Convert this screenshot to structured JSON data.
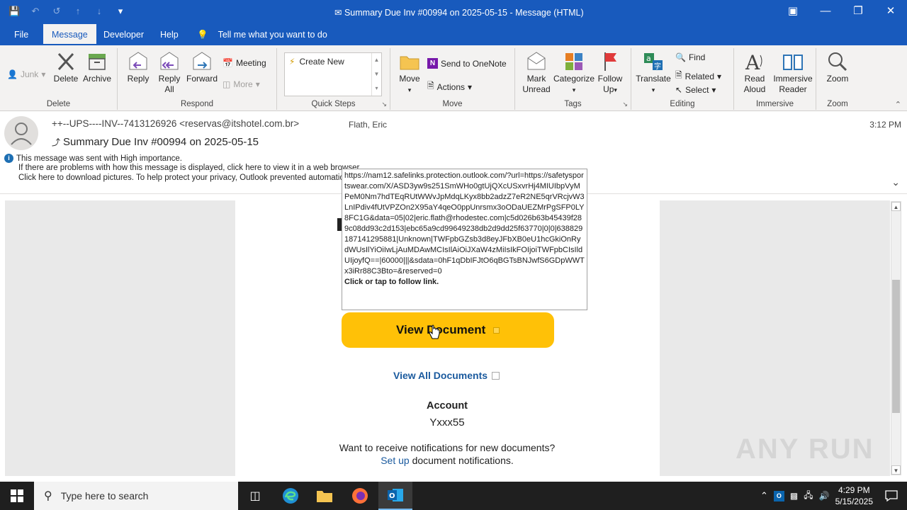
{
  "window": {
    "title": "Summary Due Inv #00994 on 2025-05-15  -  Message (HTML)",
    "controls": [
      "restore-ribbon",
      "minimize",
      "maximize",
      "close"
    ]
  },
  "tabs": [
    {
      "label": "File"
    },
    {
      "label": "Message",
      "active": true
    },
    {
      "label": "Developer"
    },
    {
      "label": "Help"
    }
  ],
  "tell_me": "Tell me what you want to do",
  "ribbon": {
    "delete_group": {
      "label": "Delete",
      "junk": "Junk",
      "delete": "Delete",
      "archive": "Archive"
    },
    "respond_group": {
      "label": "Respond",
      "reply": "Reply",
      "reply_all_1": "Reply",
      "reply_all_2": "All",
      "forward": "Forward",
      "meeting": "Meeting",
      "more": "More"
    },
    "quick_steps_group": {
      "label": "Quick Steps",
      "create_new": "Create New"
    },
    "move_group": {
      "label": "Move",
      "move": "Move",
      "onenote": "Send to OneNote",
      "actions": "Actions"
    },
    "tags_group": {
      "label": "Tags",
      "mark_unread_1": "Mark",
      "mark_unread_2": "Unread",
      "categorize": "Categorize",
      "follow_up_1": "Follow",
      "follow_up_2": "Up"
    },
    "editing_group": {
      "label": "Editing",
      "translate": "Translate",
      "find": "Find",
      "related": "Related",
      "select": "Select"
    },
    "immersive_group": {
      "label": "Immersive",
      "read_aloud_1": "Read",
      "read_aloud_2": "Aloud",
      "immersive_reader_1": "Immersive",
      "immersive_reader_2": "Reader"
    },
    "zoom_group": {
      "label": "Zoom",
      "zoom": "Zoom"
    }
  },
  "message": {
    "from": "++--UPS----INV--7413126926 <reservas@itshotel.com.br>",
    "to": "Flath, Eric",
    "time": "3:12 PM",
    "subject": "Summary Due Inv #00994 on 2025-05-15",
    "info_importance": "This message was sent with High importance.",
    "info_display": "If there are problems with how this message is displayed, click here to view it in a web browser.",
    "info_pictures": "Click here to download pictures. To help protect your privacy, Outlook prevented automatic download of some pictures in this message."
  },
  "body": {
    "view_document": "View Document",
    "view_all": "View All Documents",
    "account_label": "Account",
    "account_value": "Yxxx55",
    "notif_line1": "Want to receive notifications for new documents?",
    "setup_link": "Set up",
    "notif_line2_rest": " document notifications."
  },
  "tooltip": {
    "url": "https://nam12.safelinks.protection.outlook.com/?url=https://safetysportswear.com/X/ASD3yw9s251SmWHo0gtUjQXcUSxvrHj4MIUIbpVyMPeM0Nm7hdTEqRUtWWvJpMdqLKyx8bb2adzZ7eR2NE5qrVRcjvW3LnIPdiv4fUtVPZOn2X95aY4qeO0ppUnrsmx3oODaUEZMrPgSFP0LY8FC1G&data=05|02|eric.flath@rhodestec.com|c5d026b63b45439f289c08dd93c2d153|ebc65a9cd99649238db2d9dd25f63770|0|0|638829187141295881|Unknown|TWFpbGZsb3d8eyJFbXB0eU1hcGkiOnRydWUsIlYiOiIwLjAuMDAwMCIsIlAiOiJXaW4zMiIsIkFOIjoiTWFpbCIsIldUIjoyfQ==|60000|||&sdata=0hF1qDbIFJtO6qBGTsBNJwfS6GDpWWTx3iRr88C3Bto=&reserved=0",
    "hint": "Click or tap to follow link."
  },
  "watermark": "ANY RUN",
  "taskbar": {
    "search_placeholder": "Type here to search",
    "time": "4:29 PM",
    "date": "5/15/2025"
  },
  "colors": {
    "titlebar": "#185abd",
    "view_button": "#ffc107",
    "link": "#1a5a9e"
  }
}
